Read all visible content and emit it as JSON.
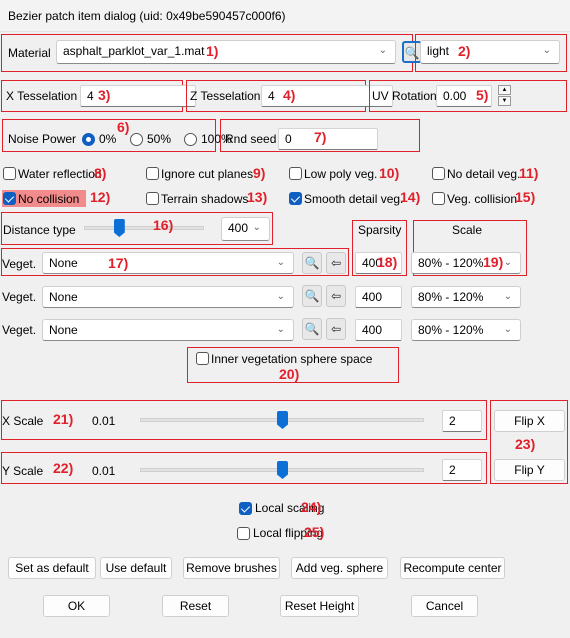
{
  "window": {
    "title": "Bezier patch item dialog (uid: 0x49be590457c000f6)"
  },
  "material": {
    "label": "Material",
    "value": "asphalt_parklot_var_1.mat",
    "annotation": "1)",
    "search_icon": "magnifier-icon",
    "assign_icon": "left-arrow-icon"
  },
  "lighting": {
    "value": "light",
    "annotation": "2)"
  },
  "x_tesselation": {
    "label": "X Tesselation",
    "value": "4",
    "annotation": "3)"
  },
  "z_tesselation": {
    "label": "Z Tesselation",
    "value": "4",
    "annotation": "4)"
  },
  "uv_rotation": {
    "label": "UV Rotation",
    "value": "0.00",
    "annotation": "5)"
  },
  "noise_power": {
    "label": "Noise Power",
    "annotation": "6)",
    "options": [
      {
        "label": "0%",
        "selected": true
      },
      {
        "label": "50%",
        "selected": false
      },
      {
        "label": "100%",
        "selected": false
      }
    ]
  },
  "rnd_seed": {
    "label": "Rnd seed",
    "value": "0",
    "annotation": "7)"
  },
  "checkboxes": [
    {
      "label": "Water reflection",
      "checked": false,
      "annotation": "8)"
    },
    {
      "label": "Ignore cut planes",
      "checked": false,
      "annotation": "9)"
    },
    {
      "label": "Low poly veg.",
      "checked": false,
      "annotation": "10)"
    },
    {
      "label": "No detail veg.",
      "checked": false,
      "annotation": "11)"
    },
    {
      "label": "No collision",
      "checked": true,
      "annotation": "12)",
      "highlight": "#f28b8b"
    },
    {
      "label": "Terrain shadows",
      "checked": false,
      "annotation": "13)"
    },
    {
      "label": "Smooth detail veg.",
      "checked": true,
      "annotation": "14)"
    },
    {
      "label": "Veg. collision",
      "checked": false,
      "annotation": "15)"
    }
  ],
  "distance": {
    "label": "Distance type",
    "slider_fraction": 0.29,
    "value": "400",
    "annotation": "16)"
  },
  "veg_headers": {
    "sparsity": "Sparsity",
    "scale": "Scale"
  },
  "vegetation": [
    {
      "label": "Veget.",
      "value": "None",
      "sparsity": "400",
      "scale": "80% - 120%",
      "annotation": "17)",
      "sparsity_annotation": "18)",
      "scale_annotation": "19)"
    },
    {
      "label": "Veget.",
      "value": "None",
      "sparsity": "400",
      "scale": "80% - 120%"
    },
    {
      "label": "Veget.",
      "value": "None",
      "sparsity": "400",
      "scale": "80% - 120%"
    }
  ],
  "inner_sphere": {
    "label": "Inner vegetation sphere space",
    "checked": false,
    "annotation": "20)"
  },
  "x_scale": {
    "label": "X Scale",
    "min": "0.01",
    "slider_fraction": 0.5,
    "value": "2",
    "annotation": "21)"
  },
  "y_scale": {
    "label": "Y Scale",
    "min": "0.01",
    "slider_fraction": 0.5,
    "value": "2",
    "annotation": "22)"
  },
  "flip": {
    "x_label": "Flip X",
    "y_label": "Flip Y",
    "annotation": "23)"
  },
  "local_scaling": {
    "label": "Local scaling",
    "checked": true,
    "annotation": "24)"
  },
  "local_flipping": {
    "label": "Local flipping",
    "checked": false,
    "annotation": "25)"
  },
  "actions": [
    "Set as default",
    "Use default",
    "Remove brushes",
    "Add veg. sphere",
    "Recompute center"
  ],
  "footer": {
    "ok": "OK",
    "reset": "Reset",
    "reset_height": "Reset Height",
    "cancel": "Cancel"
  },
  "colors": {
    "annotation_red": "#e0202a",
    "accent_blue": "#0b6fd6",
    "highlight": "#f28b8b"
  }
}
